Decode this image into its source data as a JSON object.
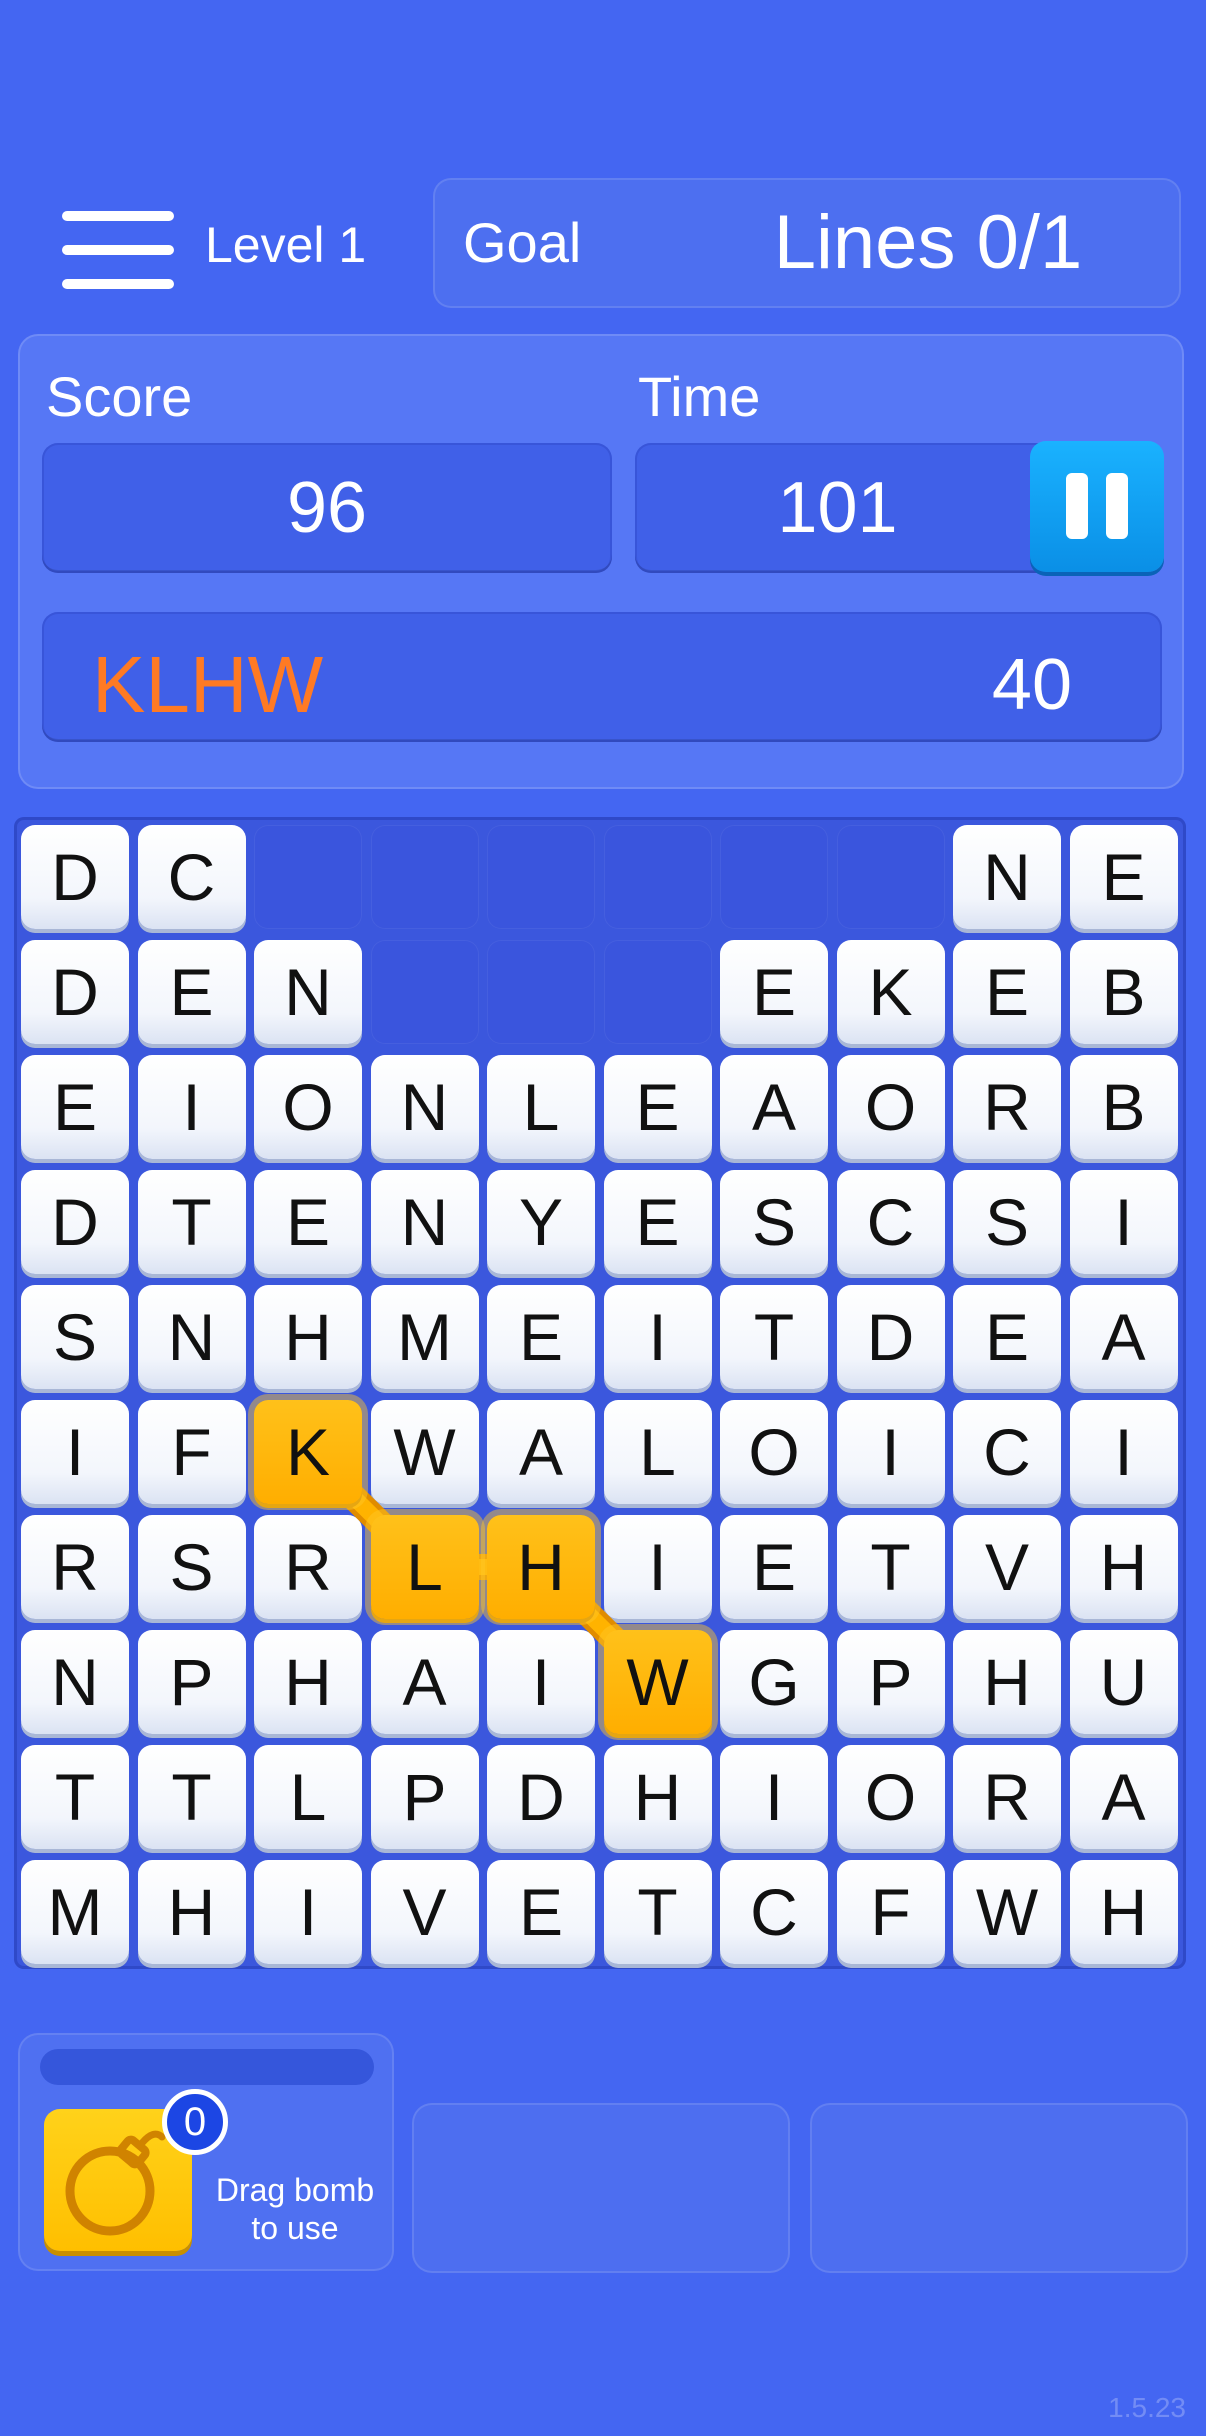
{
  "header": {
    "level_label": "Level 1",
    "goal_label": "Goal",
    "goal_value": "Lines 0/1"
  },
  "stats": {
    "score_label": "Score",
    "score_value": "96",
    "time_label": "Time",
    "time_value": "101",
    "current_word": "KLHW",
    "current_word_points": "40"
  },
  "board": {
    "rows": [
      [
        "D",
        "C",
        "",
        "",
        "",
        "",
        "",
        "",
        "N",
        "E"
      ],
      [
        "D",
        "E",
        "N",
        "",
        "",
        "",
        "E",
        "K",
        "E",
        "B"
      ],
      [
        "E",
        "I",
        "O",
        "N",
        "L",
        "E",
        "A",
        "O",
        "R",
        "B"
      ],
      [
        "D",
        "T",
        "E",
        "N",
        "Y",
        "E",
        "S",
        "C",
        "S",
        "I"
      ],
      [
        "S",
        "N",
        "H",
        "M",
        "E",
        "I",
        "T",
        "D",
        "E",
        "A"
      ],
      [
        "I",
        "F",
        "K",
        "W",
        "A",
        "L",
        "O",
        "I",
        "C",
        "I"
      ],
      [
        "R",
        "S",
        "R",
        "L",
        "H",
        "I",
        "E",
        "T",
        "V",
        "H"
      ],
      [
        "N",
        "P",
        "H",
        "A",
        "I",
        "W",
        "G",
        "P",
        "H",
        "U"
      ],
      [
        "T",
        "T",
        "L",
        "P",
        "D",
        "H",
        "I",
        "O",
        "R",
        "A"
      ],
      [
        "M",
        "H",
        "I",
        "V",
        "E",
        "T",
        "C",
        "F",
        "W",
        "H"
      ]
    ],
    "selected_path": [
      [
        5,
        2
      ],
      [
        6,
        3
      ],
      [
        6,
        4
      ],
      [
        7,
        5
      ]
    ]
  },
  "powerups": {
    "bomb_count": "0",
    "bomb_text_line1": "Drag bomb",
    "bomb_text_line2": "to use"
  },
  "version": "1.5.23",
  "colors": {
    "background": "#4466f2",
    "word_highlight": "#ff7a24",
    "selected_tile": "#ffb800",
    "pause_button": "#0fa0f5"
  }
}
